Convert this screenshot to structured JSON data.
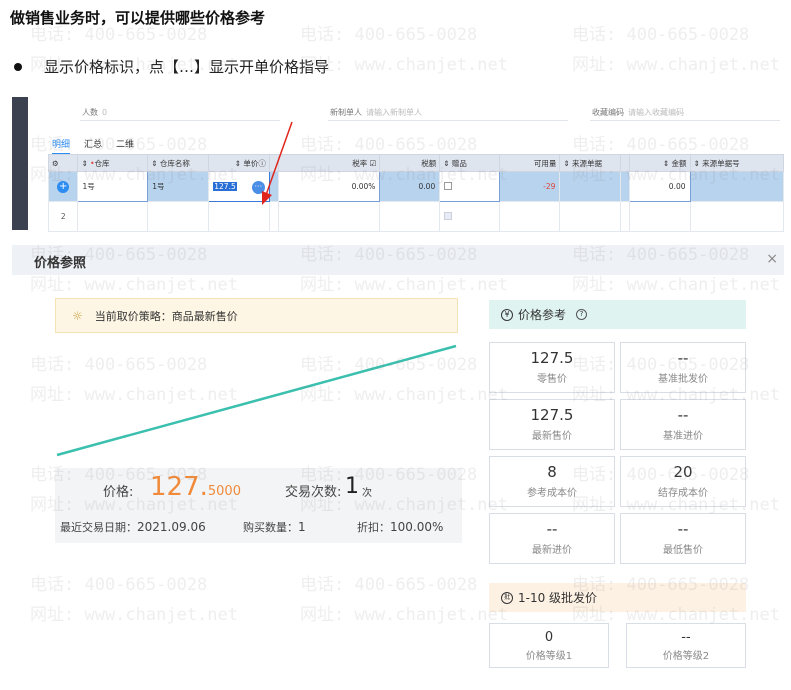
{
  "heading": "做销售业务时，可以提供哪些价格参考",
  "bullet": "显示价格标识，点【…】显示开单价格指导",
  "grid": {
    "fields": [
      {
        "label": "人数",
        "value": "0"
      },
      {
        "label": "新制单人",
        "placeholder": "请输入新制单人"
      },
      {
        "label": "收藏编码",
        "placeholder": "请输入收藏编码"
      }
    ],
    "tabs": [
      "明细",
      "汇总",
      "二维"
    ],
    "columns": [
      "",
      "仓库",
      "仓库名称",
      "单价",
      "",
      "税率",
      "税额",
      "赠品",
      "可用量",
      "来源单据",
      "",
      "金额",
      "来源单据号"
    ],
    "row1": {
      "index": "+",
      "warehouse": "1号",
      "warehouse_name": "1号",
      "unit_price": "127.5",
      "more": "···",
      "tax_rate": "0.00%",
      "tax_amount": "0.00",
      "available": "-29",
      "amount": "0.00"
    },
    "row2_index": "2"
  },
  "dialog": {
    "title": "价格参照",
    "close": "×",
    "strategy_label": "当前取价策略：",
    "strategy_value": "商品最新售价",
    "price": {
      "label": "价格:",
      "value_int": "127.",
      "value_dec": "5000",
      "trades_label": "交易次数:",
      "trades_value": "1",
      "trades_unit": "次",
      "last_date_label": "最近交易日期：",
      "last_date": "2021.09.06",
      "qty_label": "购买数量：",
      "qty": "1",
      "discount_label": "折扣：",
      "discount": "100.00%"
    },
    "ref": {
      "title": "价格参考",
      "symbol": "¥",
      "help": "?",
      "cards": [
        {
          "value": "127.5",
          "label": "零售价"
        },
        {
          "value": "--",
          "label": "基准批发价"
        },
        {
          "value": "127.5",
          "label": "最新售价"
        },
        {
          "value": "--",
          "label": "基准进价"
        },
        {
          "value": "8",
          "label": "参考成本价"
        },
        {
          "value": "20",
          "label": "结存成本价"
        },
        {
          "value": "--",
          "label": "最新进价"
        },
        {
          "value": "--",
          "label": "最低售价"
        }
      ]
    },
    "batch": {
      "title": "1-10 级批发价",
      "symbol": "批",
      "cards": [
        {
          "value": "0",
          "label": "价格等级1"
        },
        {
          "value": "--",
          "label": "价格等级2"
        }
      ]
    }
  },
  "chart_data": {
    "type": "line",
    "x": [
      0,
      1
    ],
    "series": [
      {
        "values": [
          0,
          1
        ]
      }
    ],
    "color": "#3bbfae"
  },
  "watermark": {
    "phone": "电话: 400-665-0028",
    "site": "网址: www.chanjet.net"
  }
}
